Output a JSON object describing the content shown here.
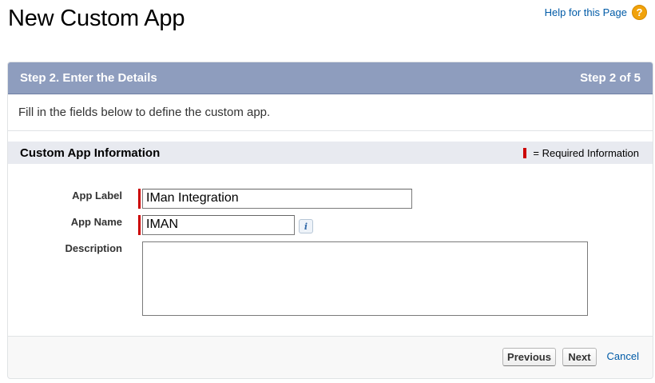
{
  "page": {
    "title": "New Custom App",
    "help_link_label": "Help for this Page",
    "help_icon_glyph": "?"
  },
  "wizard": {
    "step_title": "Step 2. Enter the Details",
    "step_indicator": "Step 2 of 5",
    "intro_text": "Fill in the fields below to define the custom app."
  },
  "section": {
    "title": "Custom App Information",
    "required_legend": "= Required Information"
  },
  "form": {
    "app_label": {
      "label": "App Label",
      "value": "IMan Integration",
      "required": true
    },
    "app_name": {
      "label": "App Name",
      "value": "IMAN",
      "required": true,
      "info_icon_glyph": "i"
    },
    "description": {
      "label": "Description",
      "value": ""
    }
  },
  "buttons": {
    "previous": "Previous",
    "next": "Next",
    "cancel": "Cancel"
  },
  "colors": {
    "header_bar": "#8e9dbe",
    "required": "#cc0000",
    "link": "#015ba7",
    "help_icon": "#f1a20a"
  }
}
